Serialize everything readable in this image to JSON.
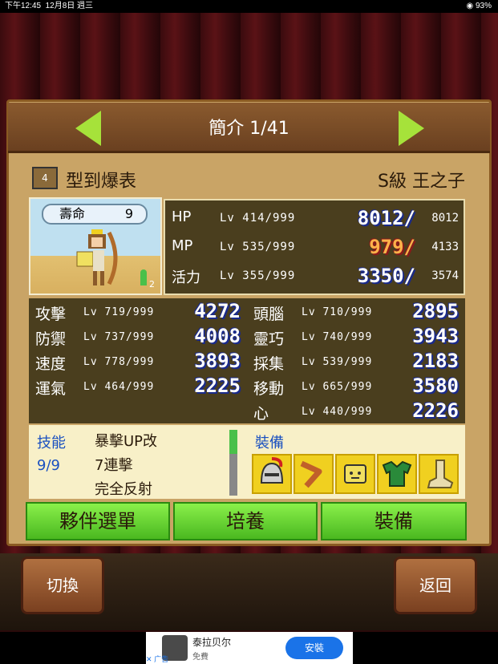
{
  "status": {
    "time": "下午12:45",
    "date": "12月8日 週三",
    "battery": "93%"
  },
  "header": {
    "title": "簡介 1/41"
  },
  "character": {
    "badge": "4",
    "name": "型到爆表",
    "rank": "S級 王之子",
    "life_label": "壽命",
    "life_value": "9",
    "sprout_count": "2"
  },
  "vitals": [
    {
      "key": "HP",
      "lv": "Lv 414/999",
      "cur": "8012/",
      "max": "8012",
      "warn": false
    },
    {
      "key": "MP",
      "lv": "Lv 535/999",
      "cur": "979/",
      "max": "4133",
      "warn": true
    },
    {
      "key": "活力",
      "lv": "Lv 355/999",
      "cur": "3350/",
      "max": "3574",
      "warn": false
    }
  ],
  "stats_left": [
    {
      "key": "攻擊",
      "lv": "Lv 719/999",
      "v": "4272"
    },
    {
      "key": "防禦",
      "lv": "Lv 737/999",
      "v": "4008"
    },
    {
      "key": "速度",
      "lv": "Lv 778/999",
      "v": "3893"
    },
    {
      "key": "運氣",
      "lv": "Lv 464/999",
      "v": "2225"
    }
  ],
  "stats_right": [
    {
      "key": "頭腦",
      "lv": "Lv 710/999",
      "v": "2895"
    },
    {
      "key": "靈巧",
      "lv": "Lv 740/999",
      "v": "3943"
    },
    {
      "key": "採集",
      "lv": "Lv 539/999",
      "v": "2183"
    },
    {
      "key": "移動",
      "lv": "Lv 665/999",
      "v": "3580"
    },
    {
      "key": "心",
      "lv": "Lv 440/999",
      "v": "2226"
    }
  ],
  "skills": {
    "label": "技能",
    "count": "9/9",
    "items": [
      "暴擊UP改",
      "7連擊",
      "完全反射"
    ]
  },
  "equipment": {
    "label": "裝備",
    "items": [
      "helmet-icon",
      "boomerang-icon",
      "charm-icon",
      "armor-icon",
      "boots-icon"
    ]
  },
  "buttons": {
    "party_menu": "夥伴選單",
    "train": "培養",
    "equip": "裝備",
    "switch": "切換",
    "back": "返回"
  },
  "ad": {
    "title": "泰拉贝尔",
    "subtitle": "免費",
    "cta": "安裝",
    "tag": "广告"
  },
  "colors": {
    "accent_green": "#a6e23a",
    "stat_bg": "#4a3e1e",
    "panel": "#c9a466",
    "skill_text": "#1a50c0"
  }
}
